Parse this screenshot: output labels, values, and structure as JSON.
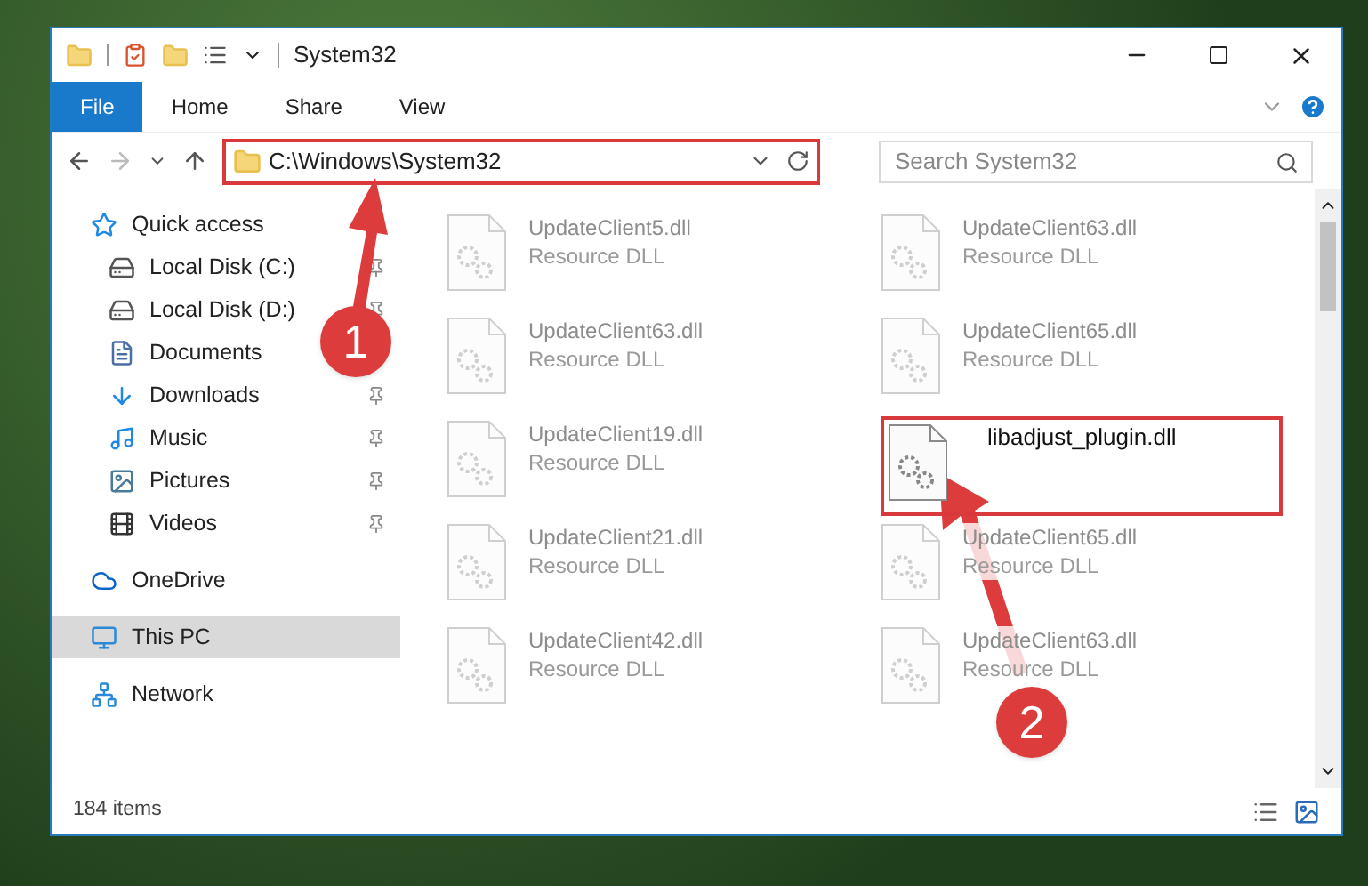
{
  "window": {
    "title": "System32"
  },
  "ribbon_tabs": [
    {
      "label": "File",
      "selected": true
    },
    {
      "label": "Home",
      "selected": false
    },
    {
      "label": "Share",
      "selected": false
    },
    {
      "label": "View",
      "selected": false
    }
  ],
  "address_bar": {
    "path": "C:\\Windows\\System32",
    "highlighted": true
  },
  "search": {
    "placeholder": "Search System32"
  },
  "sidebar": {
    "items": [
      {
        "label": "Quick access",
        "selected": false,
        "children": [
          {
            "label": "Local Disk (C:)",
            "pinned": true,
            "selected": false
          },
          {
            "label": "Local Disk (D:)",
            "pinned": true,
            "selected": false
          },
          {
            "label": "Documents",
            "selected": false
          },
          {
            "label": "Downloads",
            "pinned": true,
            "selected": false
          },
          {
            "label": "Music",
            "pinned": true,
            "selected": false
          },
          {
            "label": "Pictures",
            "pinned": true,
            "selected": false
          },
          {
            "label": "Videos",
            "pinned": true,
            "selected": false
          }
        ]
      },
      {
        "label": "OneDrive",
        "selected": false
      },
      {
        "label": "This PC",
        "selected": true
      },
      {
        "label": "Network",
        "selected": false
      }
    ]
  },
  "files": [
    {
      "name": "UpdateClient5.dll",
      "type": "Resource DLL",
      "highlighted": false
    },
    {
      "name": "UpdateClient63.dll",
      "type": "Resource DLL",
      "highlighted": false
    },
    {
      "name": "UpdateClient63.dll",
      "type": "Resource DLL",
      "highlighted": false
    },
    {
      "name": "UpdateClient65.dll",
      "type": "Resource DLL",
      "highlighted": false
    },
    {
      "name": "UpdateClient19.dll",
      "type": "Resource DLL",
      "highlighted": false
    },
    {
      "name": "libadjust_plugin.dll",
      "highlighted": true
    },
    {
      "name": "UpdateClient21.dll",
      "type": "Resource DLL",
      "highlighted": false
    },
    {
      "name": "UpdateClient65.dll",
      "type": "Resource DLL",
      "highlighted": false
    },
    {
      "name": "UpdateClient42.dll",
      "type": "Resource DLL",
      "highlighted": false
    },
    {
      "name": "UpdateClient63.dll",
      "type": "Resource DLL",
      "highlighted": false
    }
  ],
  "status_bar": {
    "item_count": "184 items"
  },
  "annotations": [
    {
      "number": "1"
    },
    {
      "number": "2"
    }
  ]
}
